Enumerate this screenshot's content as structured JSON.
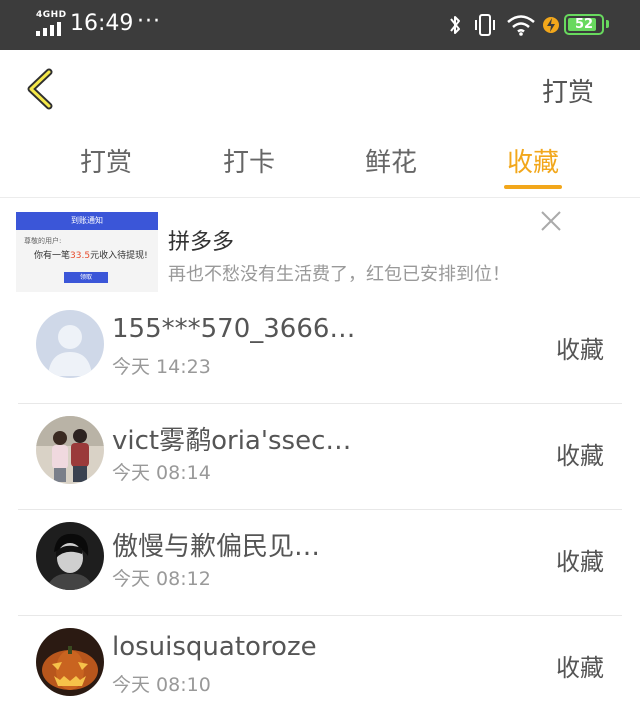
{
  "status": {
    "signal": "4GHD",
    "time": "16:49",
    "dots": "···",
    "battery": "52"
  },
  "nav": {
    "right_label": "打赏"
  },
  "tabs": [
    {
      "label": "打赏",
      "active": false
    },
    {
      "label": "打卡",
      "active": false
    },
    {
      "label": "鲜花",
      "active": false
    },
    {
      "label": "收藏",
      "active": true
    }
  ],
  "ad": {
    "image": {
      "header": "到账通知",
      "line1": "尊敬的用户:",
      "amount": "33.5",
      "line2_prefix": "你有一笔",
      "line2_suffix": "元收入待提现!",
      "button": "领取"
    },
    "title": "拼多多",
    "description": "再也不愁没有生活费了，红包已安排到位！"
  },
  "items": [
    {
      "name": "155***570_3666…",
      "time": "今天 14:23",
      "action": "收藏"
    },
    {
      "name": "vict雾鹬oria'ssec…",
      "time": "今天 08:14",
      "action": "收藏"
    },
    {
      "name": "傲慢与歉偏民见…",
      "time": "今天 08:12",
      "action": "收藏"
    },
    {
      "name": "losuisquatoroze",
      "time": "今天 08:10",
      "action": "收藏"
    }
  ],
  "colors": {
    "accent": "#f2a71b",
    "status_bar": "#3c3c3c",
    "battery": "#68d95e"
  }
}
